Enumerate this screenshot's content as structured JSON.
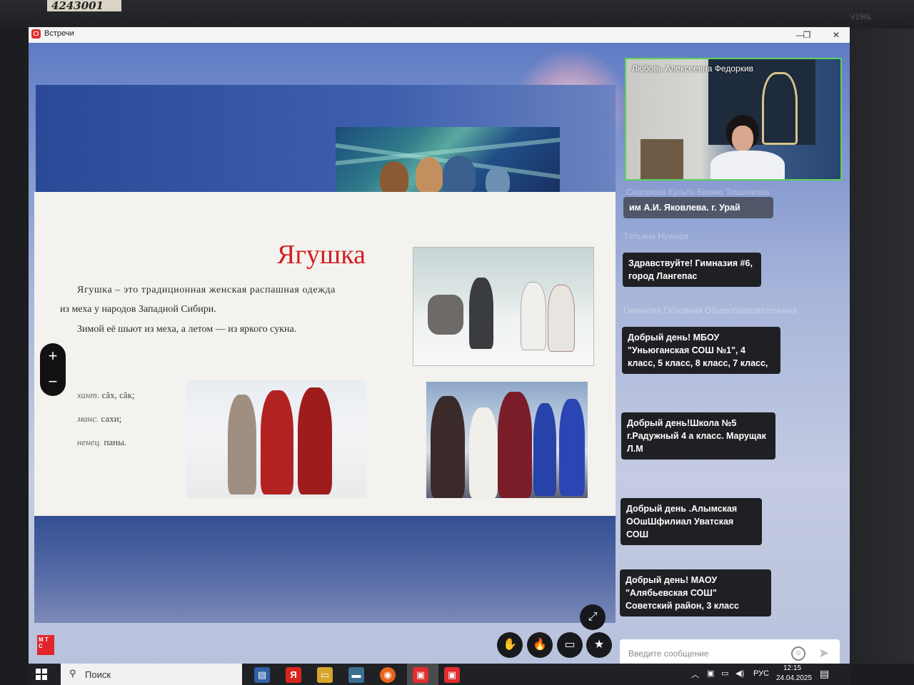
{
  "bezel": {
    "sticker": "4243001",
    "model": "V196L"
  },
  "window": {
    "title": "Встречи",
    "minimize": "—",
    "restore": "❐",
    "close": "✕"
  },
  "slide": {
    "title": "Ягушка",
    "paragraph1_line1": "Ягушка – это традиционная женская распашная одежда",
    "paragraph1_line2": "из меха у народов Западной Сибири.",
    "paragraph2": "Зимой её шьют из меха, а летом — из яркого сукна.",
    "lang1_prefix": "хант.",
    "lang1_word": "сăх, сăк;",
    "lang2_prefix": "манс.",
    "lang2_word": "сахи;",
    "lang3_prefix": "ненец.",
    "lang3_word": "паны."
  },
  "zoom": {
    "plus": "+",
    "minus": "−"
  },
  "video": {
    "participant_name": "Любовь Алексеевна Федоркив"
  },
  "chat": {
    "ghost1": "Сидорова Культо Бивню Тишинкова",
    "ghost2": "Татьяна Нужная",
    "ghost3": "Гимназия Основная Общеобразовательная",
    "messages": [
      "им А.И. Яковлева. г. Урай",
      "Здравствуйте! Гимназия #6, город Лангепас",
      "Добрый день! МБОУ \"Уньюганская СОШ №1\", 4 класс, 5 класс, 8 класс, 7 класс,",
      "Добрый день!Школа №5 г.Радужный 4 а класс. Марущак Л.М",
      "Добрый день .Алымская ООшШфилиал Уватская СОШ",
      "Добрый день! МАОУ \"Алябьевская СОШ\" Советский район, 3 класс"
    ],
    "input_placeholder": "Введите сообщение"
  },
  "controls": {
    "raise_hand": "✋",
    "reaction": "🔥",
    "screen_share": "▭",
    "star": "★",
    "fullscreen": "⤢"
  },
  "brand": {
    "logo_text": "М Т С"
  },
  "taskbar": {
    "search_label": "Поиск",
    "language": "РУС",
    "time": "12:15",
    "date": "24.04.2025"
  },
  "colors": {
    "accent_red": "#d21f1f",
    "mts_red": "#e0252e",
    "active_speaker": "#5bd15b"
  }
}
